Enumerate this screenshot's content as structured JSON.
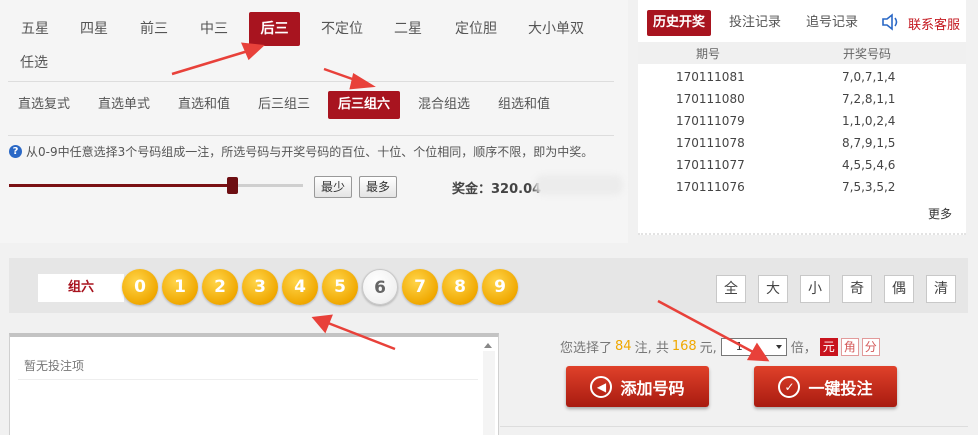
{
  "play_tabs": [
    "五星",
    "四星",
    "前三",
    "中三",
    "后三",
    "不定位",
    "二星",
    "定位胆",
    "大小单双",
    "任选"
  ],
  "active_play_tab": "后三",
  "sub_tabs": [
    "直选复式",
    "直选单式",
    "直选和值",
    "后三组三",
    "后三组六",
    "混合组选",
    "组选和值"
  ],
  "active_sub_tab": "后三组六",
  "rule_text": "从0-9中任意选择3个号码组成一注，所选号码与开奖号码的百位、十位、个位相同，顺序不限，即为中奖。",
  "slider": {
    "value": 0.76,
    "min_label": "最少",
    "max_label": "最多"
  },
  "prize_text": "奖金：320.04",
  "history": {
    "tabs": [
      "历史开奖",
      "投注记录",
      "追号记录"
    ],
    "service_label": "联系客服",
    "col_issue": "期号",
    "col_numbers": "开奖号码",
    "rows": [
      {
        "issue": "170111081",
        "numbers": "7,0,7,1,4"
      },
      {
        "issue": "170111080",
        "numbers": "7,2,8,1,1"
      },
      {
        "issue": "170111079",
        "numbers": "1,1,0,2,4"
      },
      {
        "issue": "170111078",
        "numbers": "8,7,9,1,5"
      },
      {
        "issue": "170111077",
        "numbers": "4,5,5,4,6"
      },
      {
        "issue": "170111076",
        "numbers": "7,5,3,5,2"
      }
    ],
    "more_label": "更多"
  },
  "selector": {
    "group_label": "组六",
    "balls": [
      "0",
      "1",
      "2",
      "3",
      "4",
      "5",
      "6",
      "7",
      "8",
      "9"
    ],
    "selected_ball": "6",
    "filters": [
      "全",
      "大",
      "小",
      "奇",
      "偶",
      "清"
    ]
  },
  "bet_list": {
    "empty_text": "暂无投注项"
  },
  "summary": {
    "prefix": "您选择了",
    "count": "84",
    "mid": "注, 共",
    "amount": "168",
    "yuan": "元,",
    "multiplier": "1",
    "suffix": "倍，",
    "units": [
      "元",
      "角",
      "分"
    ],
    "active_unit": "元"
  },
  "buttons": {
    "add": "添加号码",
    "quick_bet": "一键投注"
  },
  "colors": {
    "accent": "#a8141f",
    "ball": "#f0a800",
    "button": "#c8311c"
  }
}
